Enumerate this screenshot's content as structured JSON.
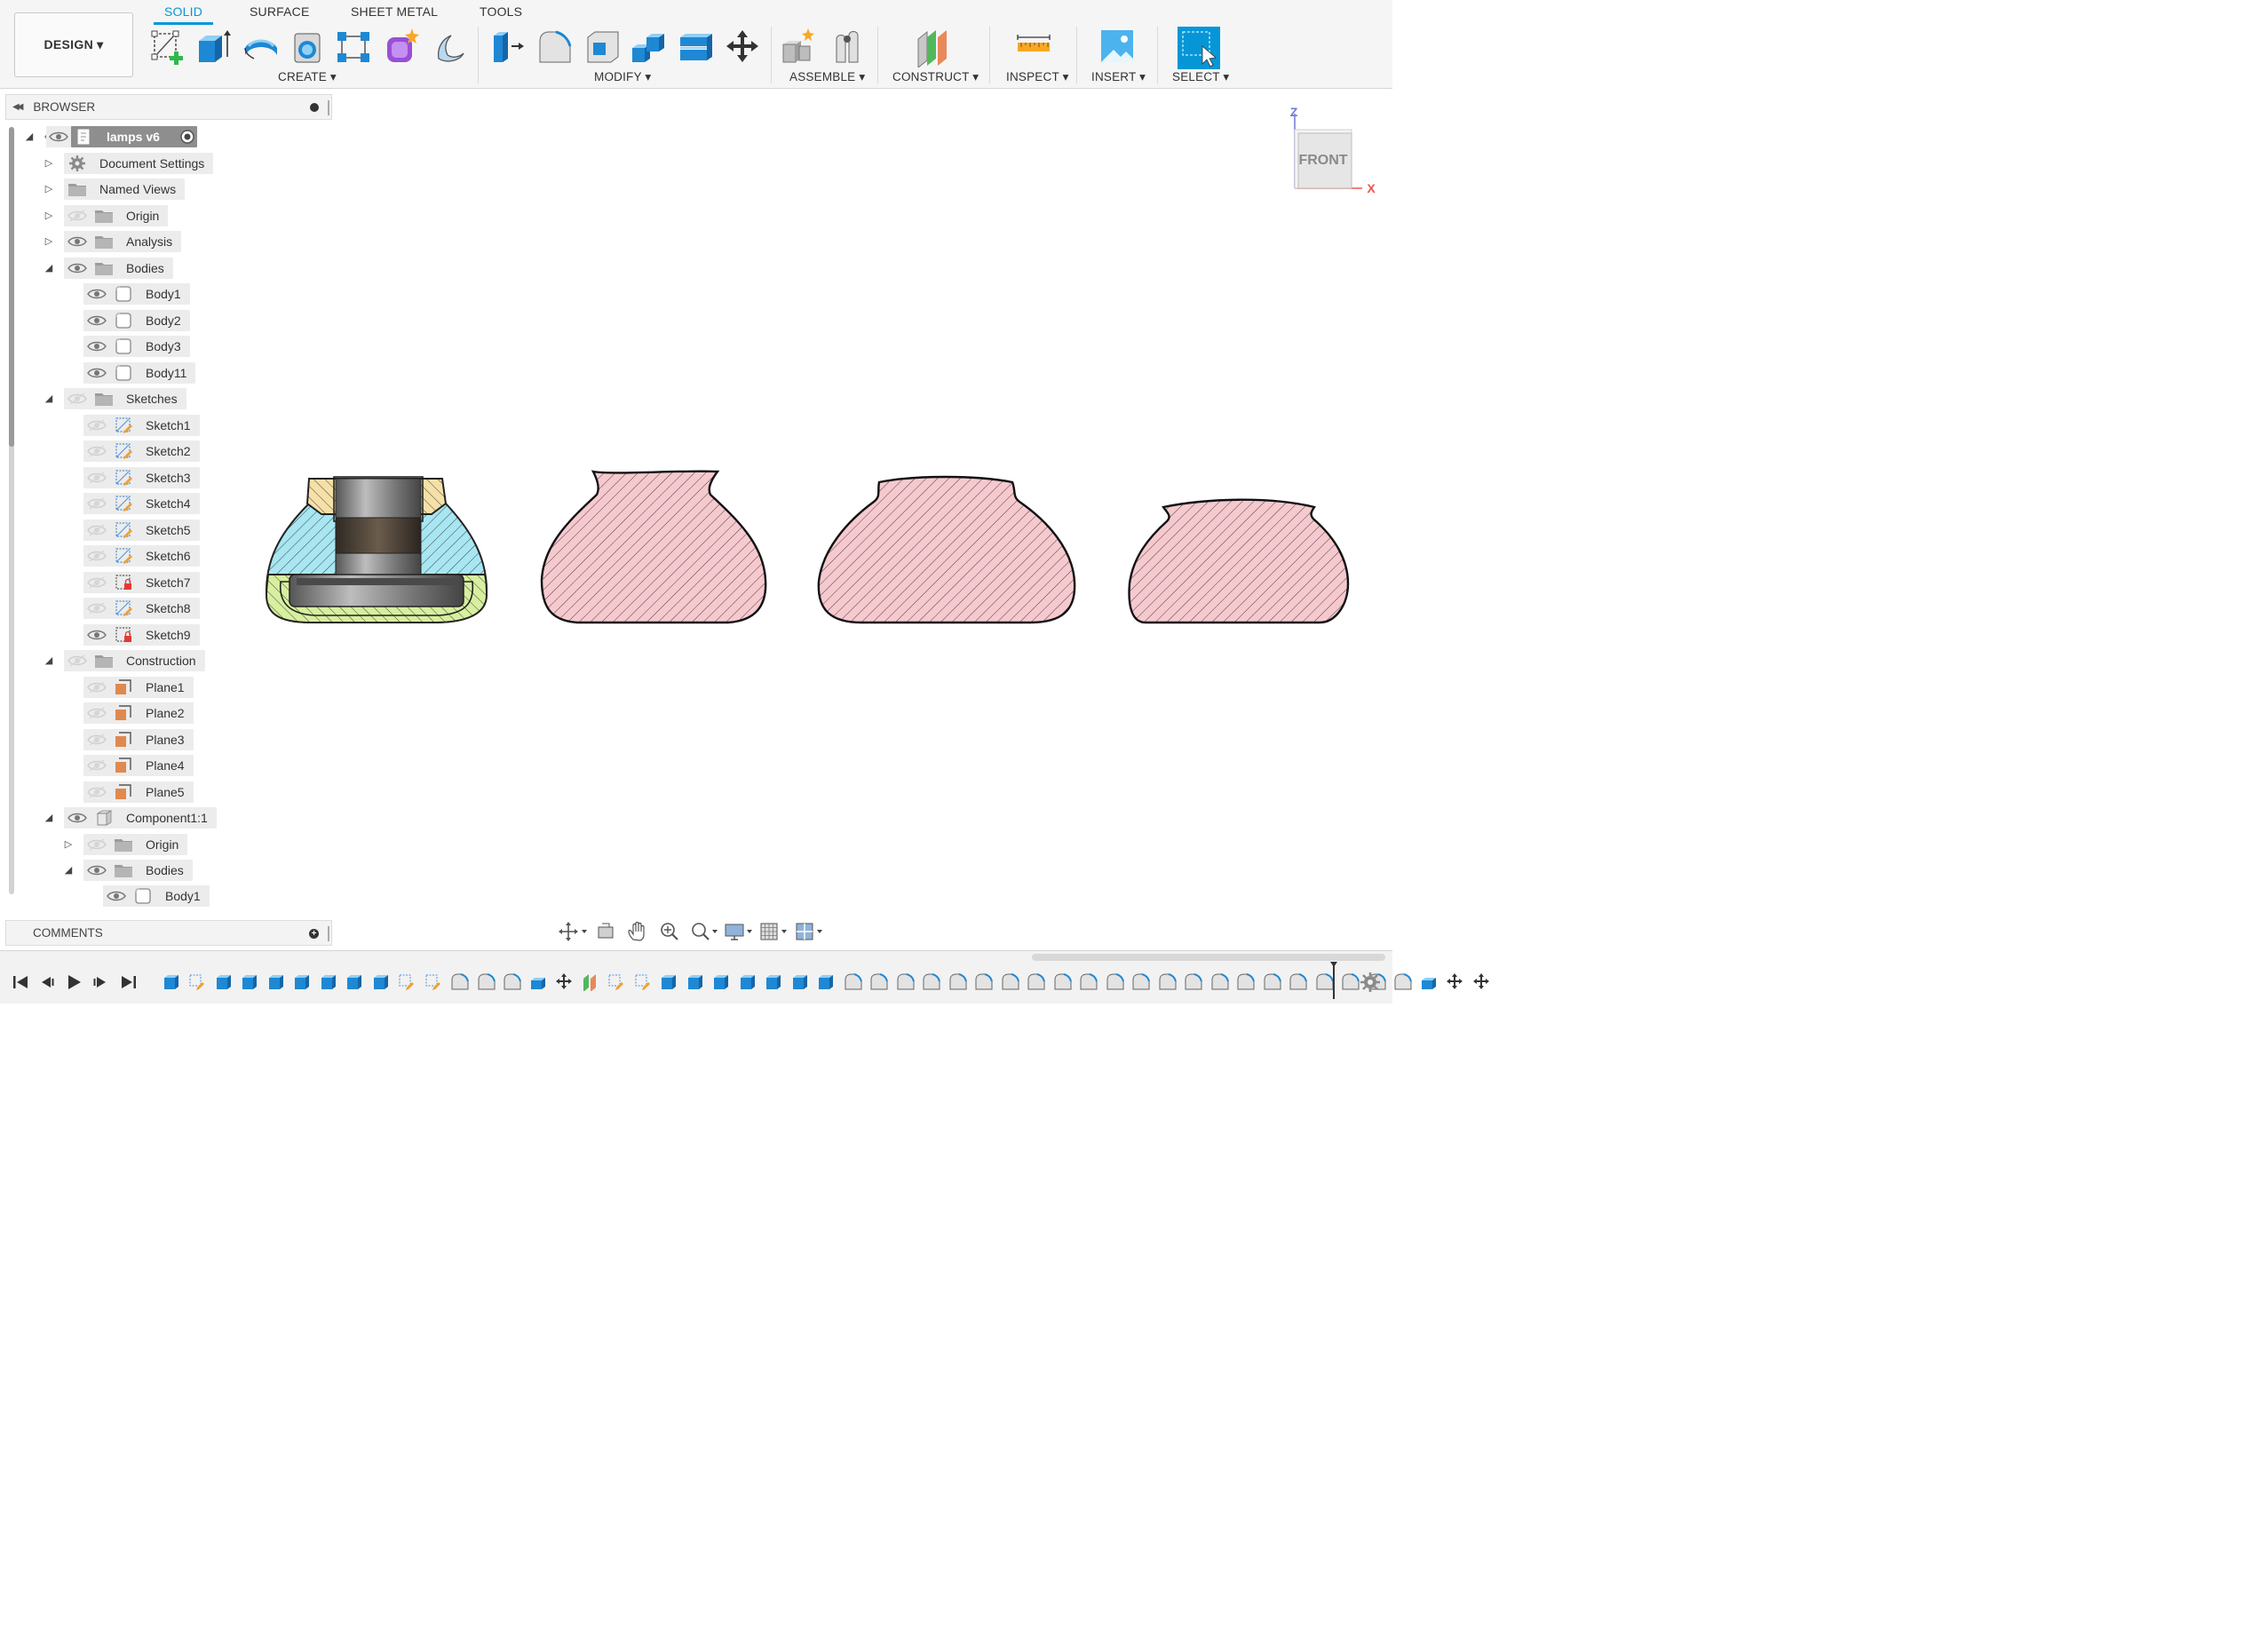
{
  "toolbar": {
    "workspace_label": "DESIGN ▾",
    "tabs": [
      "SOLID",
      "SURFACE",
      "SHEET METAL",
      "TOOLS"
    ],
    "groups": {
      "create": "CREATE ▾",
      "modify": "MODIFY ▾",
      "assemble": "ASSEMBLE ▾",
      "construct": "CONSTRUCT ▾",
      "inspect": "INSPECT ▾",
      "insert": "INSERT ▾",
      "select": "SELECT ▾"
    },
    "accent_color": "#0696d7"
  },
  "browser": {
    "title": "BROWSER",
    "root": "lamps v6",
    "items": {
      "document_settings": "Document Settings",
      "named_views": "Named Views",
      "origin": "Origin",
      "analysis": "Analysis",
      "bodies": "Bodies",
      "body1": "Body1",
      "body2": "Body2",
      "body3": "Body3",
      "body11": "Body11",
      "sketches": "Sketches",
      "sketch1": "Sketch1",
      "sketch2": "Sketch2",
      "sketch3": "Sketch3",
      "sketch4": "Sketch4",
      "sketch5": "Sketch5",
      "sketch6": "Sketch6",
      "sketch7": "Sketch7",
      "sketch8": "Sketch8",
      "sketch9": "Sketch9",
      "construction": "Construction",
      "plane1": "Plane1",
      "plane2": "Plane2",
      "plane3": "Plane3",
      "plane4": "Plane4",
      "plane5": "Plane5",
      "component": "Component1:1",
      "comp_origin": "Origin",
      "comp_bodies": "Bodies",
      "comp_body1": "Body1"
    }
  },
  "comments": {
    "title": "COMMENTS"
  },
  "viewcube": {
    "face": "FRONT",
    "axis_z": "Z",
    "axis_x": "X"
  },
  "colors": {
    "section_pink": "#f6c9cf",
    "section_blue": "#a8e6f2",
    "section_yellow": "#f5e0a8",
    "section_green": "#d7ef9e"
  }
}
